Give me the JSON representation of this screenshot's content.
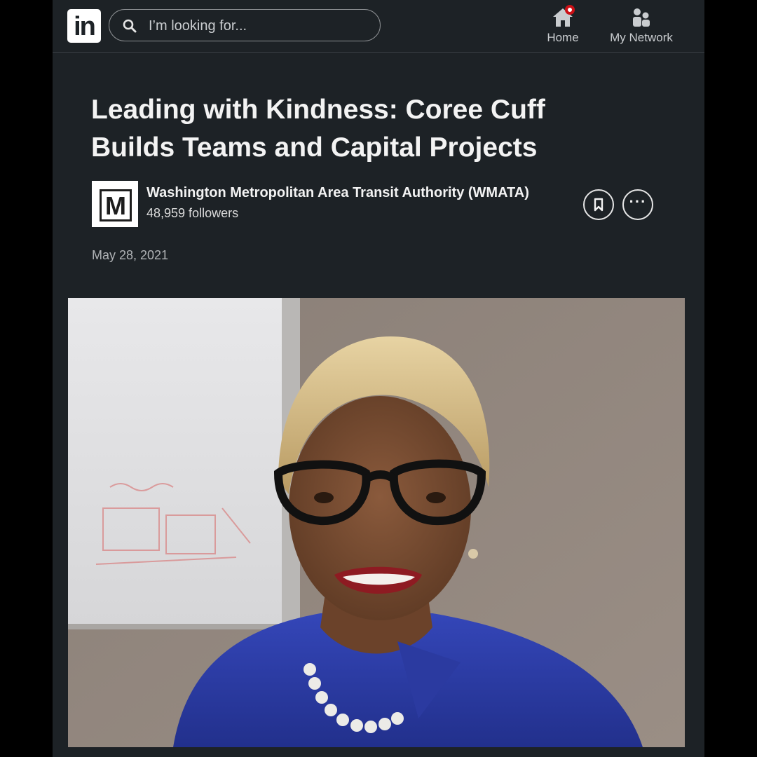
{
  "header": {
    "logo_text": "in",
    "search_placeholder": "I’m looking for...",
    "nav": [
      {
        "label": "Home",
        "icon": "home-icon",
        "has_notification": true
      },
      {
        "label": "My Network",
        "icon": "people-icon"
      }
    ],
    "notification_color": "#cc1016"
  },
  "article": {
    "title": "Leading with Kindness: Coree Cuff Builds Teams and Capital Projects",
    "author": {
      "logo_letter": "M",
      "name": "Washington Metropolitan Area Transit Authority (WMATA)",
      "followers": "48,959 followers"
    },
    "date": "May 28, 2021",
    "actions": {
      "save_icon": "bookmark-icon",
      "more_icon": "more-dots-icon",
      "more_text": "···"
    },
    "hero_image": "portrait-photo"
  },
  "colors": {
    "background": "#1d2226",
    "text_primary": "#f3f3f3",
    "text_secondary": "#b0b3b6"
  }
}
